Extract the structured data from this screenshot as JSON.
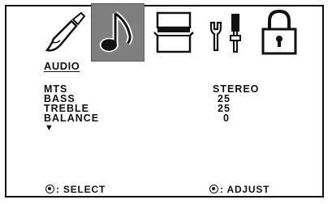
{
  "tabs": [
    {
      "icon": "paintbrush-icon",
      "active": false
    },
    {
      "icon": "music-note-icon",
      "active": true
    },
    {
      "icon": "tv-box-icon",
      "active": false
    },
    {
      "icon": "tools-icon",
      "active": false
    },
    {
      "icon": "lock-icon",
      "active": false
    }
  ],
  "section_title": "AUDIO",
  "settings": [
    {
      "label": "MTS",
      "value": "STEREO"
    },
    {
      "label": "BASS",
      "value": "25"
    },
    {
      "label": "TREBLE",
      "value": "25"
    },
    {
      "label": "BALANCE",
      "value": "0"
    }
  ],
  "more_indicator": "▼",
  "footer": {
    "select_label": ": SELECT",
    "adjust_label": ": ADJUST"
  },
  "colors": {
    "active_tab": "#7f7f7f",
    "foreground": "#111111",
    "background": "#ffffff"
  }
}
